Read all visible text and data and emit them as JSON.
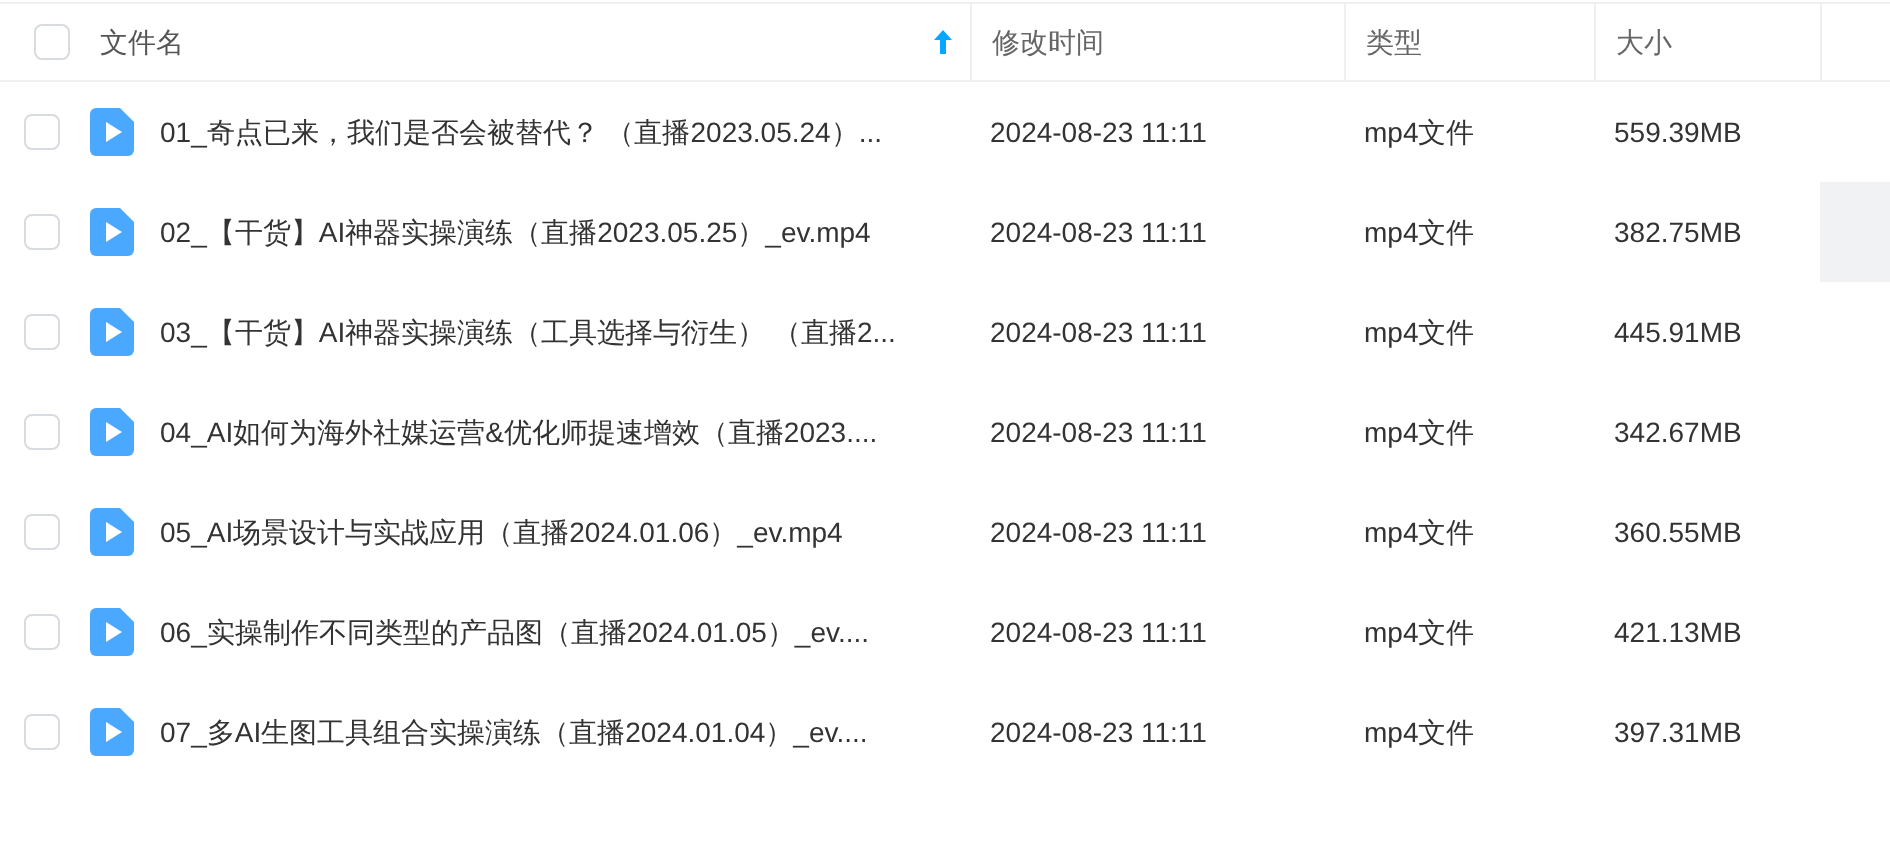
{
  "header": {
    "select_all_checked": false,
    "columns": [
      {
        "label": "文件名",
        "sorted": true
      },
      {
        "label": "修改时间",
        "sorted": false
      },
      {
        "label": "类型",
        "sorted": false
      },
      {
        "label": "大小",
        "sorted": false
      }
    ]
  },
  "rows": [
    {
      "checked": false,
      "hovered": false,
      "name": "01_奇点已来，我们是否会被替代？ （直播2023.05.24）...",
      "modified": "2024-08-23 11:11",
      "type": "mp4文件",
      "size": "559.39MB"
    },
    {
      "checked": false,
      "hovered": true,
      "name": "02_【干货】AI神器实操演练（直播2023.05.25）_ev.mp4",
      "modified": "2024-08-23 11:11",
      "type": "mp4文件",
      "size": "382.75MB"
    },
    {
      "checked": false,
      "hovered": false,
      "name": "03_【干货】AI神器实操演练（工具选择与衍生） （直播2...",
      "modified": "2024-08-23 11:11",
      "type": "mp4文件",
      "size": "445.91MB"
    },
    {
      "checked": false,
      "hovered": false,
      "name": "04_AI如何为海外社媒运营&优化师提速增效（直播2023....",
      "modified": "2024-08-23 11:11",
      "type": "mp4文件",
      "size": "342.67MB"
    },
    {
      "checked": false,
      "hovered": false,
      "name": "05_AI场景设计与实战应用（直播2024.01.06）_ev.mp4",
      "modified": "2024-08-23 11:11",
      "type": "mp4文件",
      "size": "360.55MB"
    },
    {
      "checked": false,
      "hovered": false,
      "name": "06_实操制作不同类型的产品图（直播2024.01.05）_ev....",
      "modified": "2024-08-23 11:11",
      "type": "mp4文件",
      "size": "421.13MB"
    },
    {
      "checked": false,
      "hovered": false,
      "name": "07_多AI生图工具组合实操演练（直播2024.01.04）_ev....",
      "modified": "2024-08-23 11:11",
      "type": "mp4文件",
      "size": "397.31MB"
    }
  ]
}
